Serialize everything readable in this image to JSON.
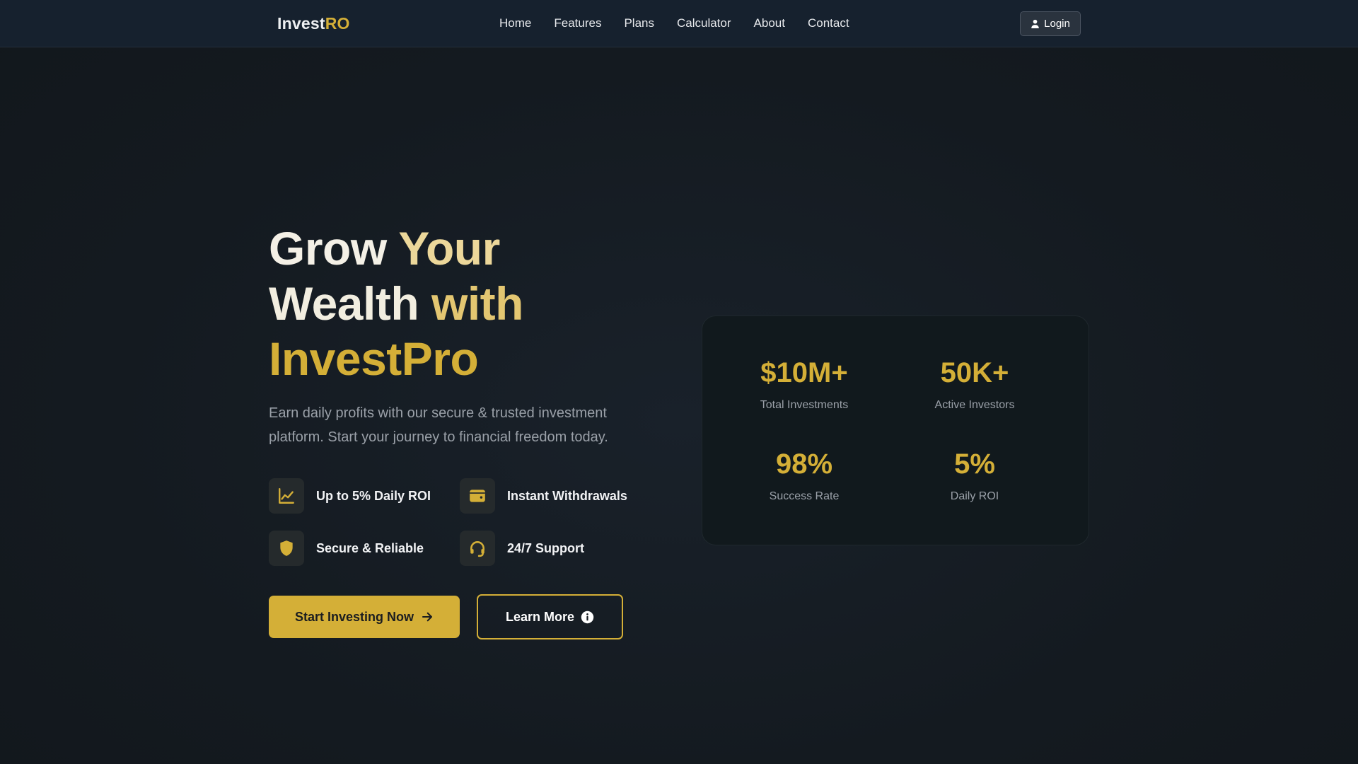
{
  "brand": {
    "part1": "Invest",
    "part2": "RO"
  },
  "nav": {
    "links": [
      "Home",
      "Features",
      "Plans",
      "Calculator",
      "About",
      "Contact"
    ],
    "login_label": "Login"
  },
  "hero": {
    "title_words": [
      "Grow",
      "Your",
      "Wealth",
      "with",
      "InvestPro"
    ],
    "subtitle": "Earn daily profits with our secure & trusted investment platform. Start your journey to financial freedom today.",
    "features": [
      {
        "label": "Up to 5% Daily ROI",
        "icon": "chart-line-icon"
      },
      {
        "label": "Instant Withdrawals",
        "icon": "wallet-icon"
      },
      {
        "label": "Secure & Reliable",
        "icon": "shield-icon"
      },
      {
        "label": "24/7 Support",
        "icon": "headset-icon"
      }
    ],
    "primary_button": "Start Investing Now",
    "secondary_button": "Learn More"
  },
  "stats": [
    {
      "value": "$10M+",
      "caption": "Total Investments"
    },
    {
      "value": "50K+",
      "caption": "Active Investors"
    },
    {
      "value": "98%",
      "caption": "Success Rate"
    },
    {
      "value": "5%",
      "caption": "Daily ROI"
    }
  ],
  "colors": {
    "accent": "#d4af37",
    "background": "#141a20",
    "navbar": "#16212e"
  }
}
